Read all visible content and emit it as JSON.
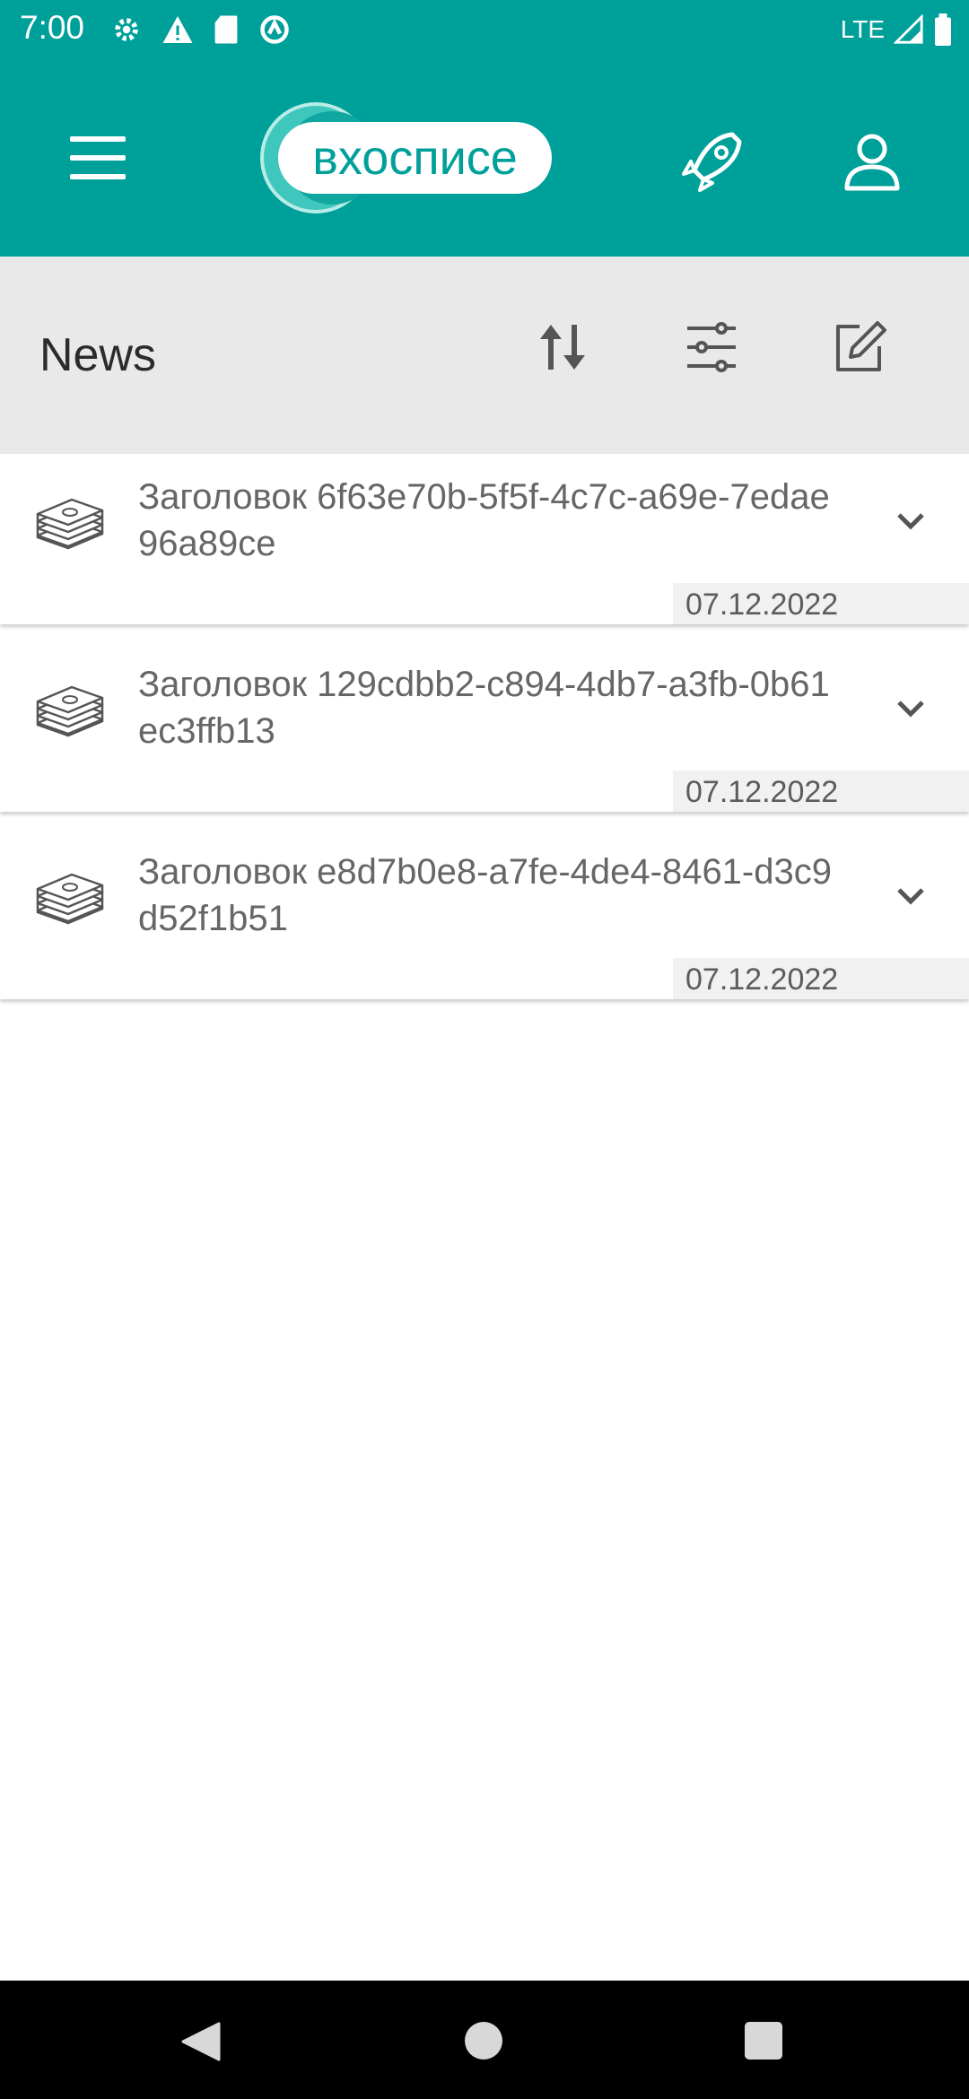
{
  "status_bar": {
    "time": "7:00",
    "network": "LTE",
    "icons": [
      "settings-gear-icon",
      "warning-icon",
      "sd-card-icon",
      "sync-icon",
      "signal-icon",
      "battery-icon"
    ]
  },
  "app_bar": {
    "logo_text": "вхосписе",
    "background": "#00a09a",
    "icons": [
      "hamburger-menu-icon",
      "rocket-icon",
      "profile-icon"
    ]
  },
  "toolbar": {
    "title": "News",
    "background": "#e9e9e9",
    "icons": [
      "sort-icon",
      "filter-sliders-icon",
      "edit-icon"
    ]
  },
  "news": [
    {
      "title": "Заголовок 6f63e70b-5f5f-4c7c-a69e-7edae96a89ce",
      "date": "07.12.2022",
      "icon": "money-stack-icon"
    },
    {
      "title": "Заголовок 129cdbb2-c894-4db7-a3fb-0b61ec3ffb13",
      "date": "07.12.2022",
      "icon": "money-stack-icon"
    },
    {
      "title": "Заголовок e8d7b0e8-a7fe-4de4-8461-d3c9d52f1b51",
      "date": "07.12.2022",
      "icon": "money-stack-icon"
    }
  ],
  "nav_bar": {
    "icons": [
      "back-icon",
      "home-icon",
      "recents-icon"
    ]
  }
}
